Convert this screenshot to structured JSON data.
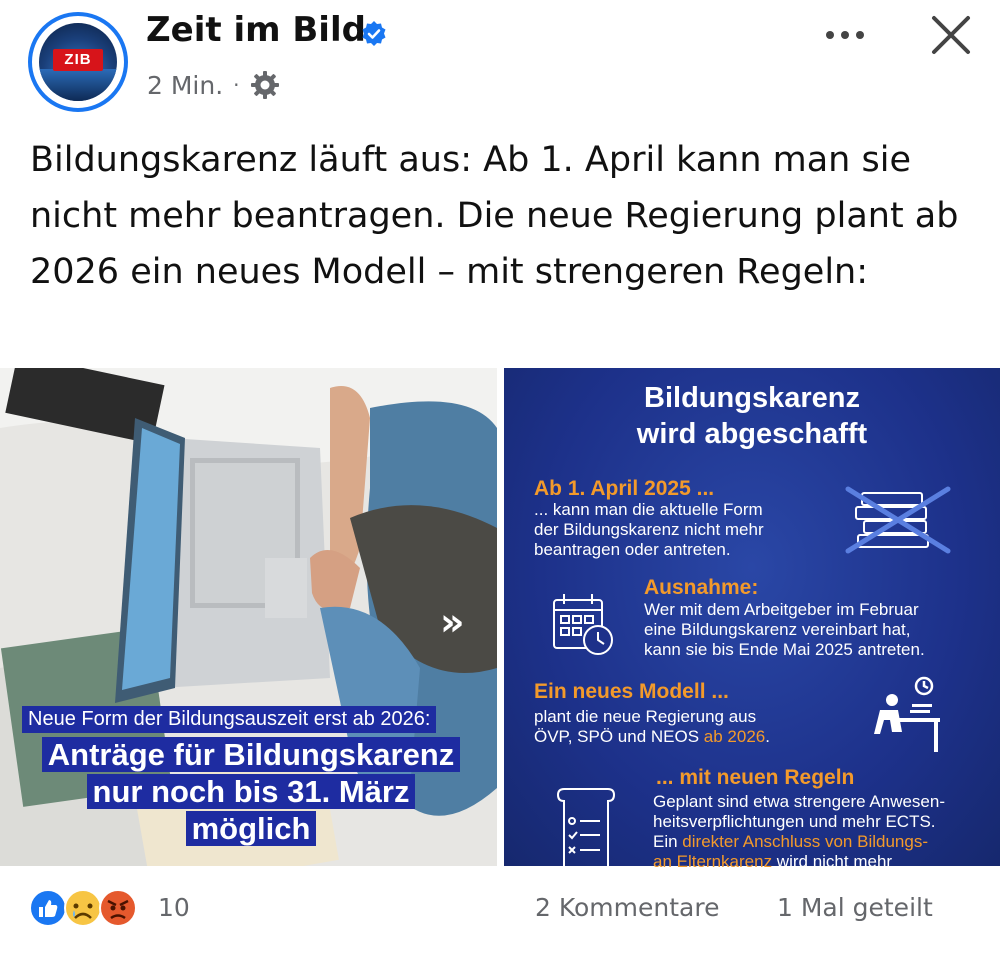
{
  "header": {
    "page_name": "Zeit im Bild",
    "avatar_logo": "ZIB",
    "timestamp": "2 Min.",
    "separator": "·",
    "audience_icon": "gear-icon",
    "more_icon": "more-dots-icon",
    "close_icon": "close-icon",
    "verified_color": "#1a77f2"
  },
  "post": {
    "text": "Bildungskarenz läuft aus: Ab 1. April kann man sie nicht mehr beantragen. Die neue Regierung plant ab 2026 ein neues Modell – mit strengeren Regeln:"
  },
  "media_left": {
    "tag": "Neue Form der Bildungsauszeit erst ab 2026:",
    "headline_lines": [
      "Anträge für Bildungskarenz",
      "nur noch bis 31. März",
      "möglich"
    ],
    "next_icon": "double-chevron-right-icon"
  },
  "infographic": {
    "title_lines": [
      "Bildungskarenz",
      "wird abgeschafft"
    ],
    "section1_heading": "Ab 1. April 2025 ...",
    "section1_lines": [
      "... kann man die aktuelle Form",
      "der Bildungskarenz nicht mehr",
      "beantragen oder antreten."
    ],
    "section2_heading": "Ausnahme:",
    "section2_lines": [
      "Wer mit dem Arbeitgeber im Februar",
      "eine Bildungskarenz vereinbart hat,",
      "kann sie bis Ende Mai 2025 antreten."
    ],
    "section3_heading": "Ein neues Modell ...",
    "section3_line1": "plant die neue Regierung aus",
    "section3_line2_pre": "ÖVP, SPÖ und NEOS ",
    "section3_line2_hl": "ab 2026",
    "section3_line2_post": ".",
    "section4_heading": "... mit neuen Regeln",
    "section4_line1": "Geplant sind etwa strengere Anwesen-",
    "section4_line2": "heitsverpflichtungen und mehr ECTS.",
    "section4_line3_pre": "Ein ",
    "section4_line3_hl": "direkter Anschluss von Bildungs-",
    "section4_line4_hl": "an Elternkarenz",
    "section4_line4_post": " wird nicht mehr",
    "accent_color": "#f39a2b"
  },
  "footer": {
    "reaction_icons": [
      "like-icon",
      "sad-icon",
      "angry-icon"
    ],
    "reaction_count": "10",
    "comments": "2 Kommentare",
    "shares": "1 Mal geteilt"
  }
}
